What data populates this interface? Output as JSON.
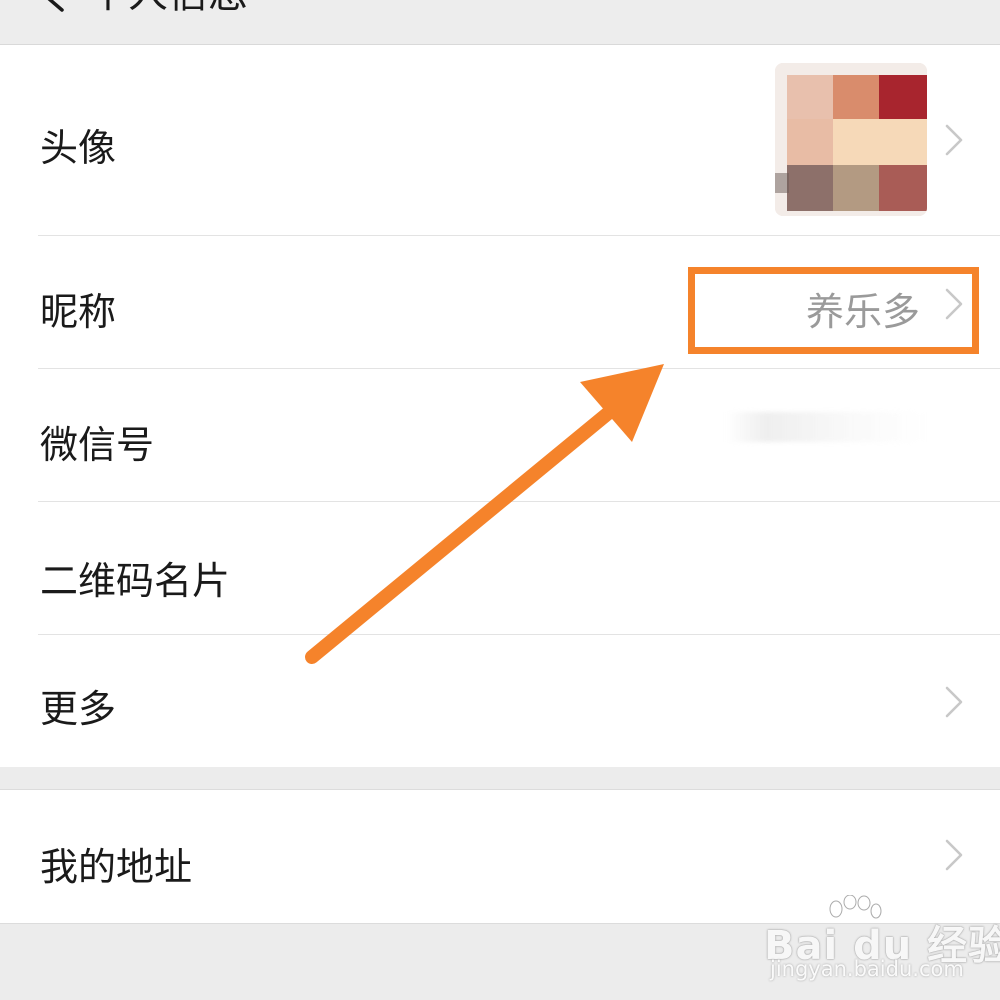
{
  "header": {
    "title": "个人信息"
  },
  "rows": {
    "avatar": {
      "label": "头像"
    },
    "nickname": {
      "label": "昵称",
      "value": "养乐多"
    },
    "wechat_id": {
      "label": "微信号"
    },
    "qr_card": {
      "label": "二维码名片"
    },
    "more": {
      "label": "更多"
    },
    "address": {
      "label": "我的地址"
    }
  },
  "icons": {
    "back": "back-arrow-icon",
    "chevron": "chevron-right-icon"
  },
  "annotation": {
    "color": "#f5832b"
  },
  "watermark": {
    "brand": "Bai du 经验",
    "url": "jingyan.baidu.com"
  }
}
